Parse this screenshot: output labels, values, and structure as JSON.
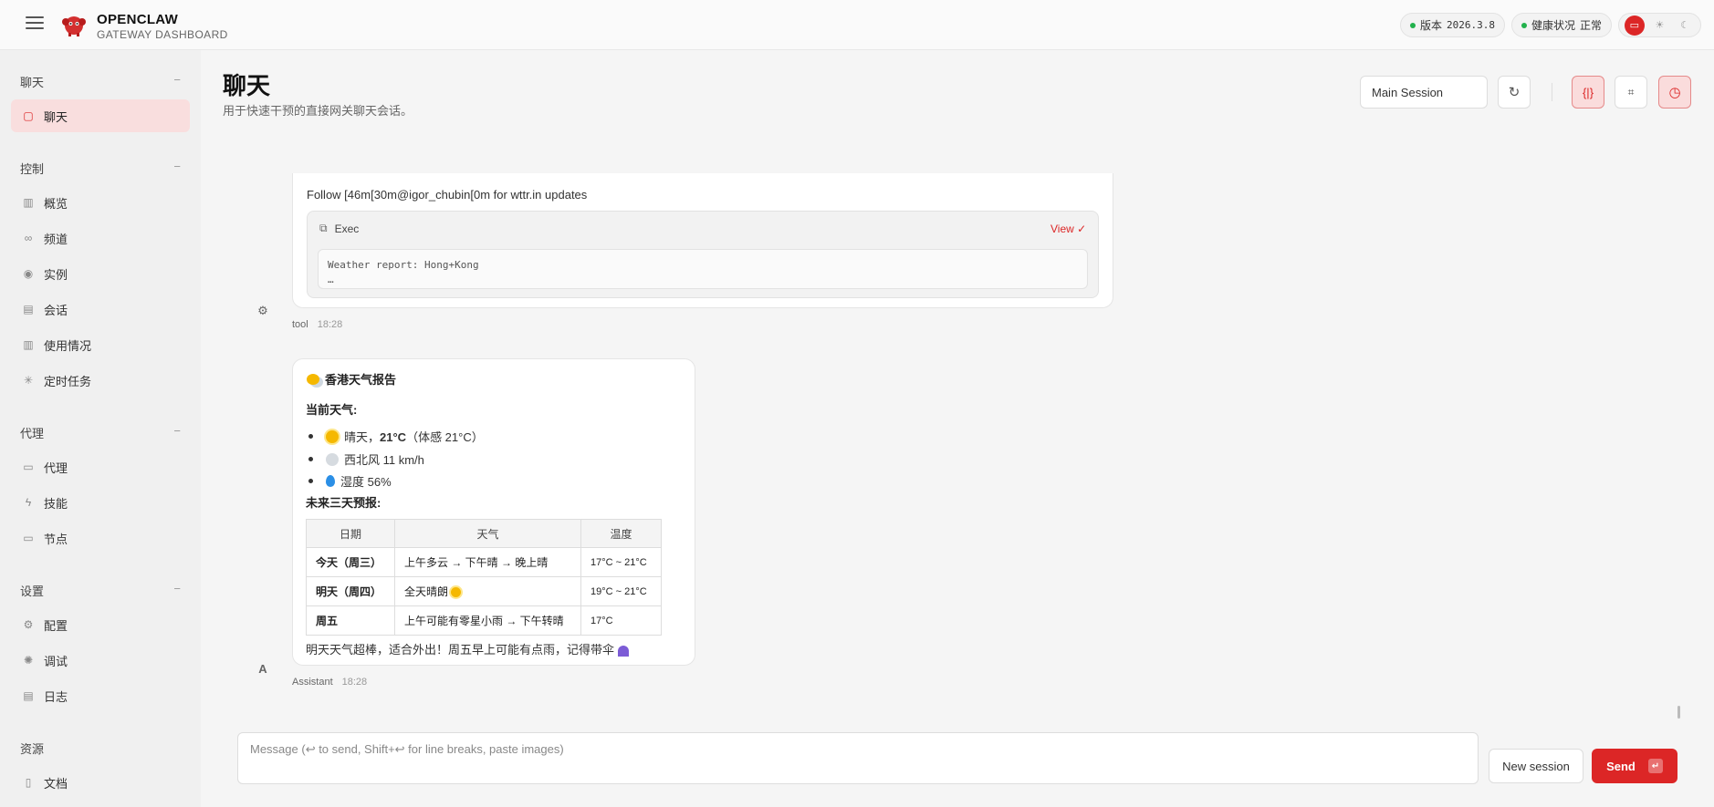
{
  "topbar": {
    "brand_title": "OPENCLAW",
    "brand_subtitle": "GATEWAY DASHBOARD",
    "version_label": "版本",
    "version_value": "2026.3.8",
    "health_label": "健康状况",
    "health_value": "正常",
    "status_color": "#22b14c",
    "accent_color": "#dc2626"
  },
  "sidebar": {
    "sections": [
      {
        "title": "聊天",
        "items": [
          {
            "label": "聊天",
            "icon": "message-icon"
          }
        ]
      },
      {
        "title": "控制",
        "items": [
          {
            "label": "概览",
            "icon": "bar-chart-icon"
          },
          {
            "label": "频道",
            "icon": "link-icon"
          },
          {
            "label": "实例",
            "icon": "radio-icon"
          },
          {
            "label": "会话",
            "icon": "file-icon"
          },
          {
            "label": "使用情况",
            "icon": "bar-chart-icon"
          },
          {
            "label": "定时任务",
            "icon": "loader-icon"
          }
        ]
      },
      {
        "title": "代理",
        "items": [
          {
            "label": "代理",
            "icon": "folder-icon"
          },
          {
            "label": "技能",
            "icon": "bolt-icon"
          },
          {
            "label": "节点",
            "icon": "monitor-icon"
          }
        ]
      },
      {
        "title": "设置",
        "items": [
          {
            "label": "配置",
            "icon": "gear-icon"
          },
          {
            "label": "调试",
            "icon": "bug-icon"
          },
          {
            "label": "日志",
            "icon": "scroll-icon"
          }
        ]
      },
      {
        "title": "资源",
        "items": [
          {
            "label": "文档",
            "icon": "book-icon"
          }
        ]
      }
    ],
    "collapse_symbol": "−"
  },
  "header": {
    "title": "聊天",
    "subtitle": "用于快速干预的直接网关聊天会话。",
    "session_select": "Main Session"
  },
  "chat": {
    "tool_message": {
      "text": "Follow [46m[30m@igor_chubin[0m for wttr.in updates",
      "exec_label": "Exec",
      "view_label": "View ✓",
      "code_line1": "Weather report: Hong+Kong",
      "code_line2": "…",
      "sender": "tool",
      "time": "18:28"
    },
    "assistant_message": {
      "title": "香港天气报告",
      "current_heading": "当前天气:",
      "current_items": [
        {
          "pre": "晴天，",
          "bold": "21°C",
          "post": "（体感 21°C）"
        },
        {
          "pre": "西北风 11 km/h",
          "bold": "",
          "post": ""
        },
        {
          "pre": "湿度 56%",
          "bold": "",
          "post": ""
        }
      ],
      "forecast_heading": "未来三天预报:",
      "table": {
        "headers": [
          "日期",
          "天气",
          "温度"
        ],
        "rows": [
          [
            "今天（周三）",
            "上午多云 → 下午晴 → 晚上晴",
            "17°C ~ 21°C"
          ],
          [
            "明天（周四）",
            "全天晴朗",
            "19°C ~ 21°C"
          ],
          [
            "周五",
            "上午可能有零星小雨 → 下午转晴",
            "17°C"
          ]
        ]
      },
      "closing": "明天天气超棒，适合外出！周五早上可能有点雨，记得带伞",
      "sender": "Assistant",
      "time": "18:28",
      "avatar_letter": "A"
    }
  },
  "composer": {
    "placeholder": "Message (↩ to send, Shift+↩ for line breaks, paste images)",
    "new_session_label": "New session",
    "send_label": "Send",
    "send_key": "↵"
  }
}
